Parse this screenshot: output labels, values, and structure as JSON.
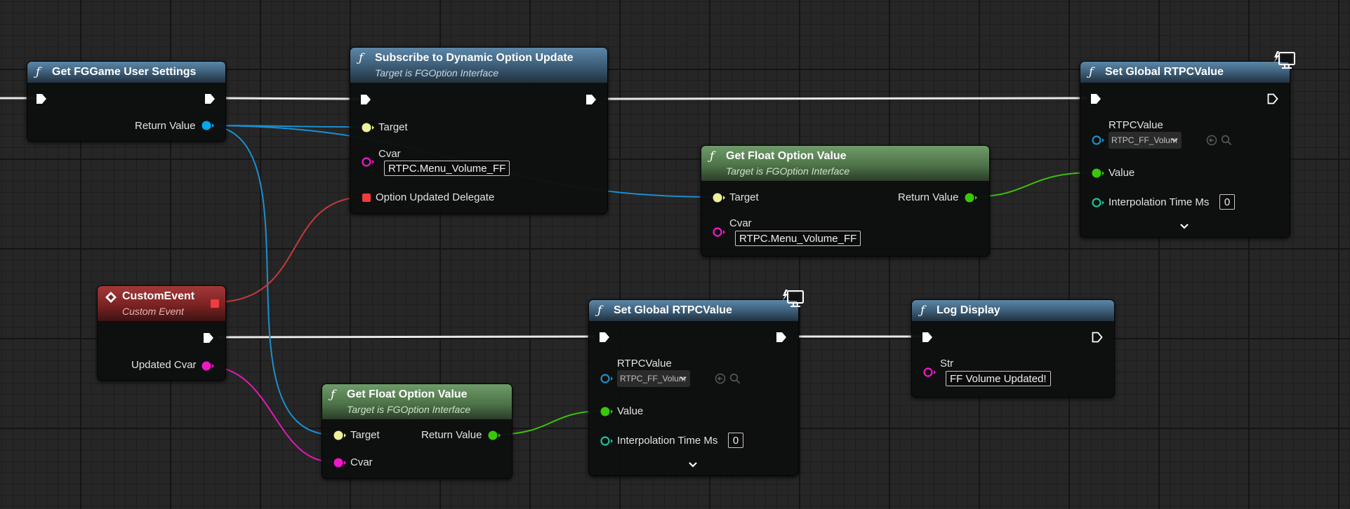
{
  "graph": {
    "nodes": {
      "get_user_settings": {
        "title": "Get FGGame User Settings",
        "return_label": "Return Value"
      },
      "subscribe": {
        "title": "Subscribe to Dynamic Option Update",
        "subtitle": "Target is FGOption Interface",
        "target_label": "Target",
        "cvar_label": "Cvar",
        "cvar_value": "RTPC.Menu_Volume_FF",
        "delegate_label": "Option Updated Delegate"
      },
      "get_float_top": {
        "title": "Get Float Option Value",
        "subtitle": "Target is FGOption Interface",
        "target_label": "Target",
        "return_label": "Return Value",
        "cvar_label": "Cvar",
        "cvar_value": "RTPC.Menu_Volume_FF"
      },
      "set_rtpc_top": {
        "title": "Set Global RTPCValue",
        "rtpc_label": "RTPCValue",
        "rtpc_value": "RTPC_FF_Volum",
        "value_label": "Value",
        "interp_label": "Interpolation Time Ms",
        "interp_value": "0"
      },
      "custom_event": {
        "title": "CustomEvent",
        "subtitle": "Custom Event",
        "param_label": "Updated Cvar"
      },
      "get_float_bottom": {
        "title": "Get Float Option Value",
        "subtitle": "Target is FGOption Interface",
        "target_label": "Target",
        "return_label": "Return Value",
        "cvar_label": "Cvar"
      },
      "set_rtpc_bottom": {
        "title": "Set Global RTPCValue",
        "rtpc_label": "RTPCValue",
        "rtpc_value": "RTPC_FF_Volum",
        "value_label": "Value",
        "interp_label": "Interpolation Time Ms",
        "interp_value": "0"
      },
      "log_display": {
        "title": "Log Display",
        "str_label": "Str",
        "str_value": "FF Volume Updated!"
      }
    },
    "icons": {
      "function": "function-icon",
      "event": "event-icon",
      "editor_only": "editor-only-monitor-icon",
      "reset": "reset-to-default-icon",
      "browse": "browse-search-icon",
      "advanced": "chevron-down-icon"
    },
    "colors": {
      "exec_wire": "#ffffff",
      "object_pin": "#00a8f0",
      "interface_pin": "#eef09c",
      "string_pin": "#f018c8",
      "float_pin": "#39c70a",
      "delegate_pin": "#f03c3c",
      "rtpc_pin": "#1e8ec8",
      "int_pin": "#1ec09c"
    }
  }
}
